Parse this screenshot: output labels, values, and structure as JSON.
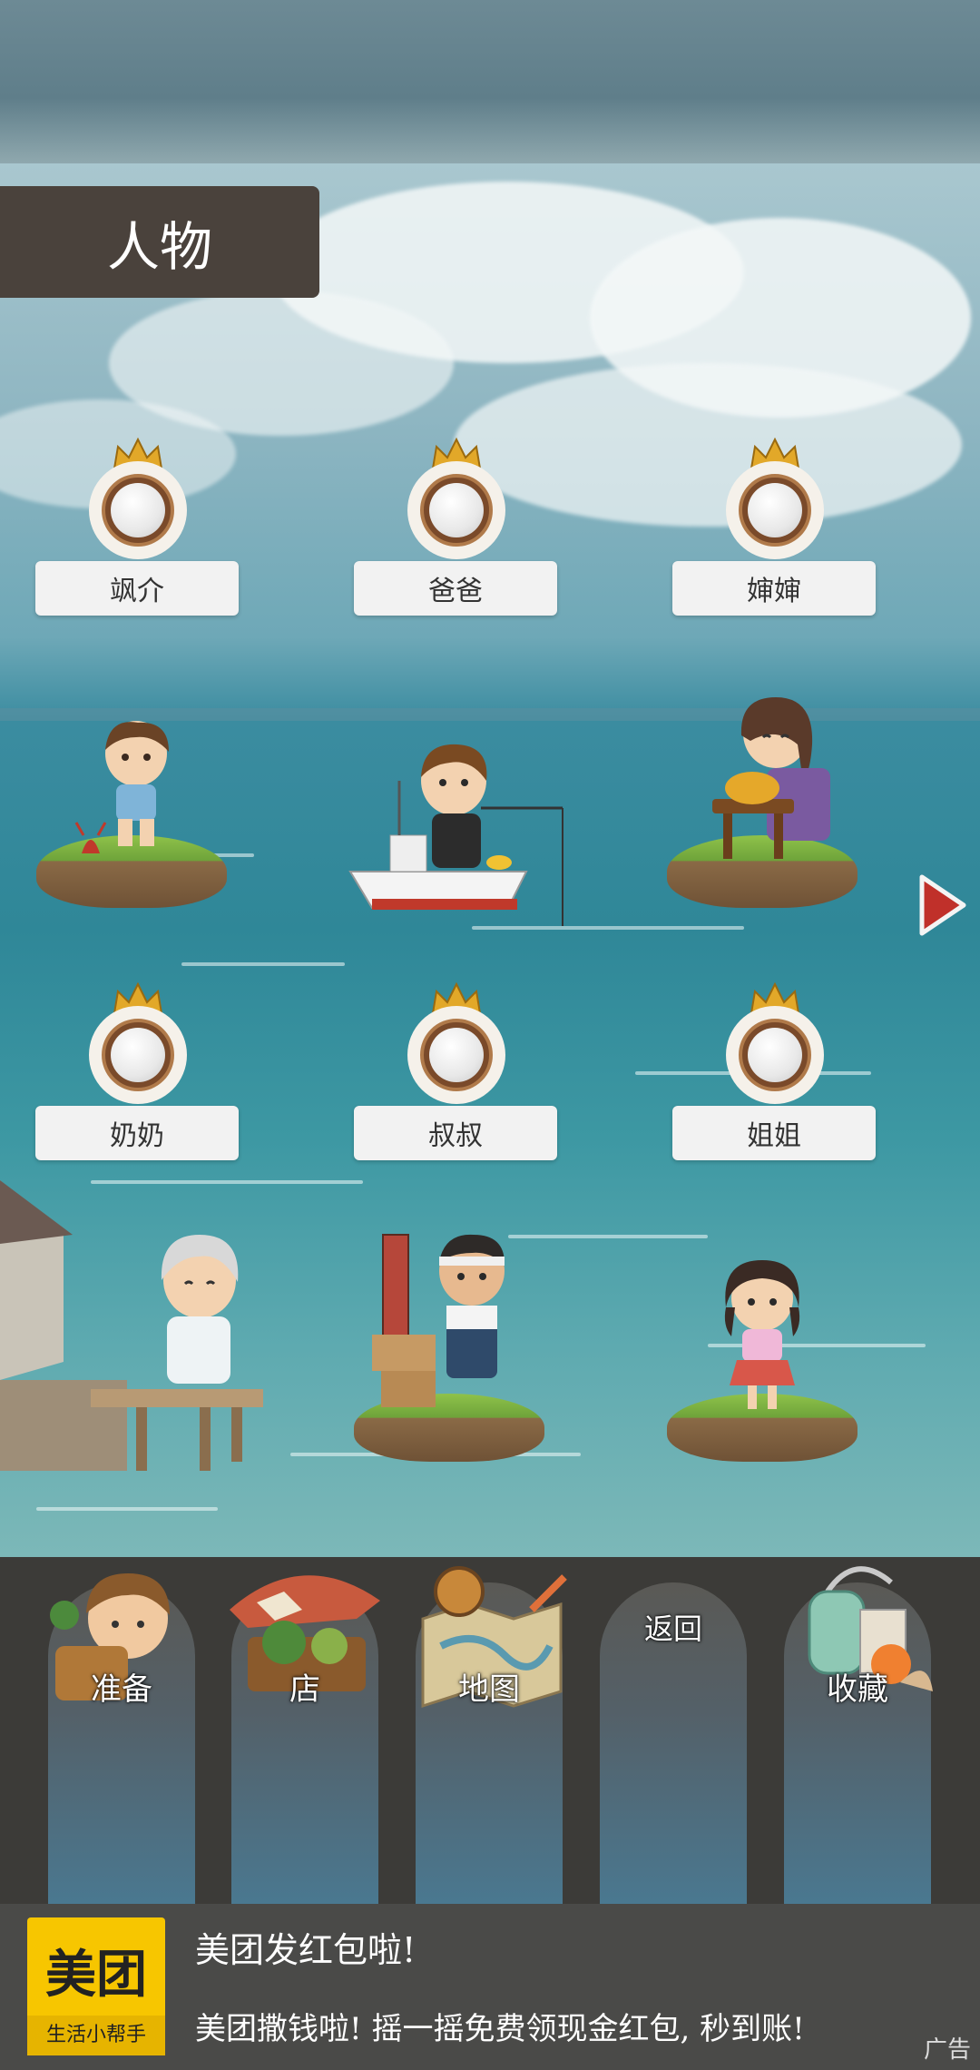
{
  "header": {
    "title": "人物"
  },
  "characters": [
    {
      "name": "飒介"
    },
    {
      "name": "爸爸"
    },
    {
      "name": "婶婶"
    },
    {
      "name": "奶奶"
    },
    {
      "name": "叔叔"
    },
    {
      "name": "姐姐"
    }
  ],
  "dock": {
    "items": [
      {
        "label": "准备",
        "icon": "backpack-boy-icon"
      },
      {
        "label": "店",
        "icon": "shop-stall-icon"
      },
      {
        "label": "地图",
        "icon": "map-icon"
      },
      {
        "label": "返回",
        "icon": ""
      },
      {
        "label": "收藏",
        "icon": "collection-bag-icon"
      }
    ]
  },
  "ad": {
    "logo_main": "美团",
    "logo_sub": "生活小帮手",
    "title": "美团发红包啦!",
    "text": "美团撒钱啦! 摇一摇免费领现金红包, 秒到账!",
    "tag": "广告"
  },
  "colors": {
    "title_tab": "#4a423c",
    "dock_bg": "#3c3b38",
    "arrow": "#c0302a",
    "ad_logo": "#f7c600"
  }
}
